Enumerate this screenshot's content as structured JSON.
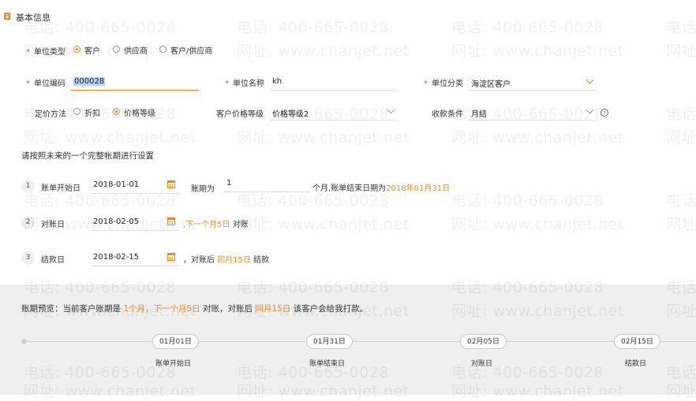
{
  "section": {
    "title": "基本信息"
  },
  "unit_type": {
    "label": "单位类型",
    "options": [
      {
        "label": "客户",
        "selected": true
      },
      {
        "label": "供应商",
        "selected": false
      },
      {
        "label": "客户/供应商",
        "selected": false
      }
    ]
  },
  "unit_code": {
    "label": "单位编码",
    "value": "000028"
  },
  "unit_name": {
    "label": "单位名称",
    "value": "kh"
  },
  "unit_category": {
    "label": "单位分类",
    "value": "海淀区客户"
  },
  "pricing_method": {
    "label": "定价方法",
    "options": [
      {
        "label": "折扣",
        "selected": false
      },
      {
        "label": "价格等级",
        "selected": true
      }
    ]
  },
  "customer_price_level": {
    "label": "客户价格等级",
    "value": "价格等级2"
  },
  "payment_terms": {
    "label": "收款条件",
    "value": "月结"
  },
  "billing": {
    "instruction": "请按照未来的一个完整帐期进行设置",
    "step1": {
      "num": "1",
      "label": "账单开始日",
      "date": "2018-01-01",
      "period_label": "账期为",
      "period_value": "1",
      "suffix": "个月,账单结束日期为",
      "end_date": "2018年01月31日"
    },
    "step2": {
      "num": "2",
      "label": "对账日",
      "date": "2018-02-05",
      "note_orange": ",下一个月5日",
      "note": " 对账"
    },
    "step3": {
      "num": "3",
      "label": "结款日",
      "date": "2018-02-15",
      "note_prefix": "，对账后 ",
      "note_orange": "同月15日",
      "note": " 结款"
    }
  },
  "preview": {
    "prefix": "账期预览：当前客户账期是 ",
    "h1": "1个月",
    "sep1": "，",
    "h2": "下一个月5日",
    "mid": " 对账，对账后 ",
    "h3": "同月15日",
    "suffix": " 该客户会给我打款。",
    "timeline": [
      {
        "date": "01月01日",
        "label": "账单开始日"
      },
      {
        "date": "01月31日",
        "label": "账单结束日"
      },
      {
        "date": "02月05日",
        "label": "对账日"
      },
      {
        "date": "02月15日",
        "label": "结款日"
      }
    ]
  },
  "watermark": {
    "phone": "电话: 400-665-0028",
    "site": "网址: www.chanjet.net",
    "phone_short": "电话",
    "site_short": "网址"
  },
  "colors": {
    "accent": "#f08a1f",
    "required": "#e8572b",
    "preview_bg": "#efefef"
  }
}
